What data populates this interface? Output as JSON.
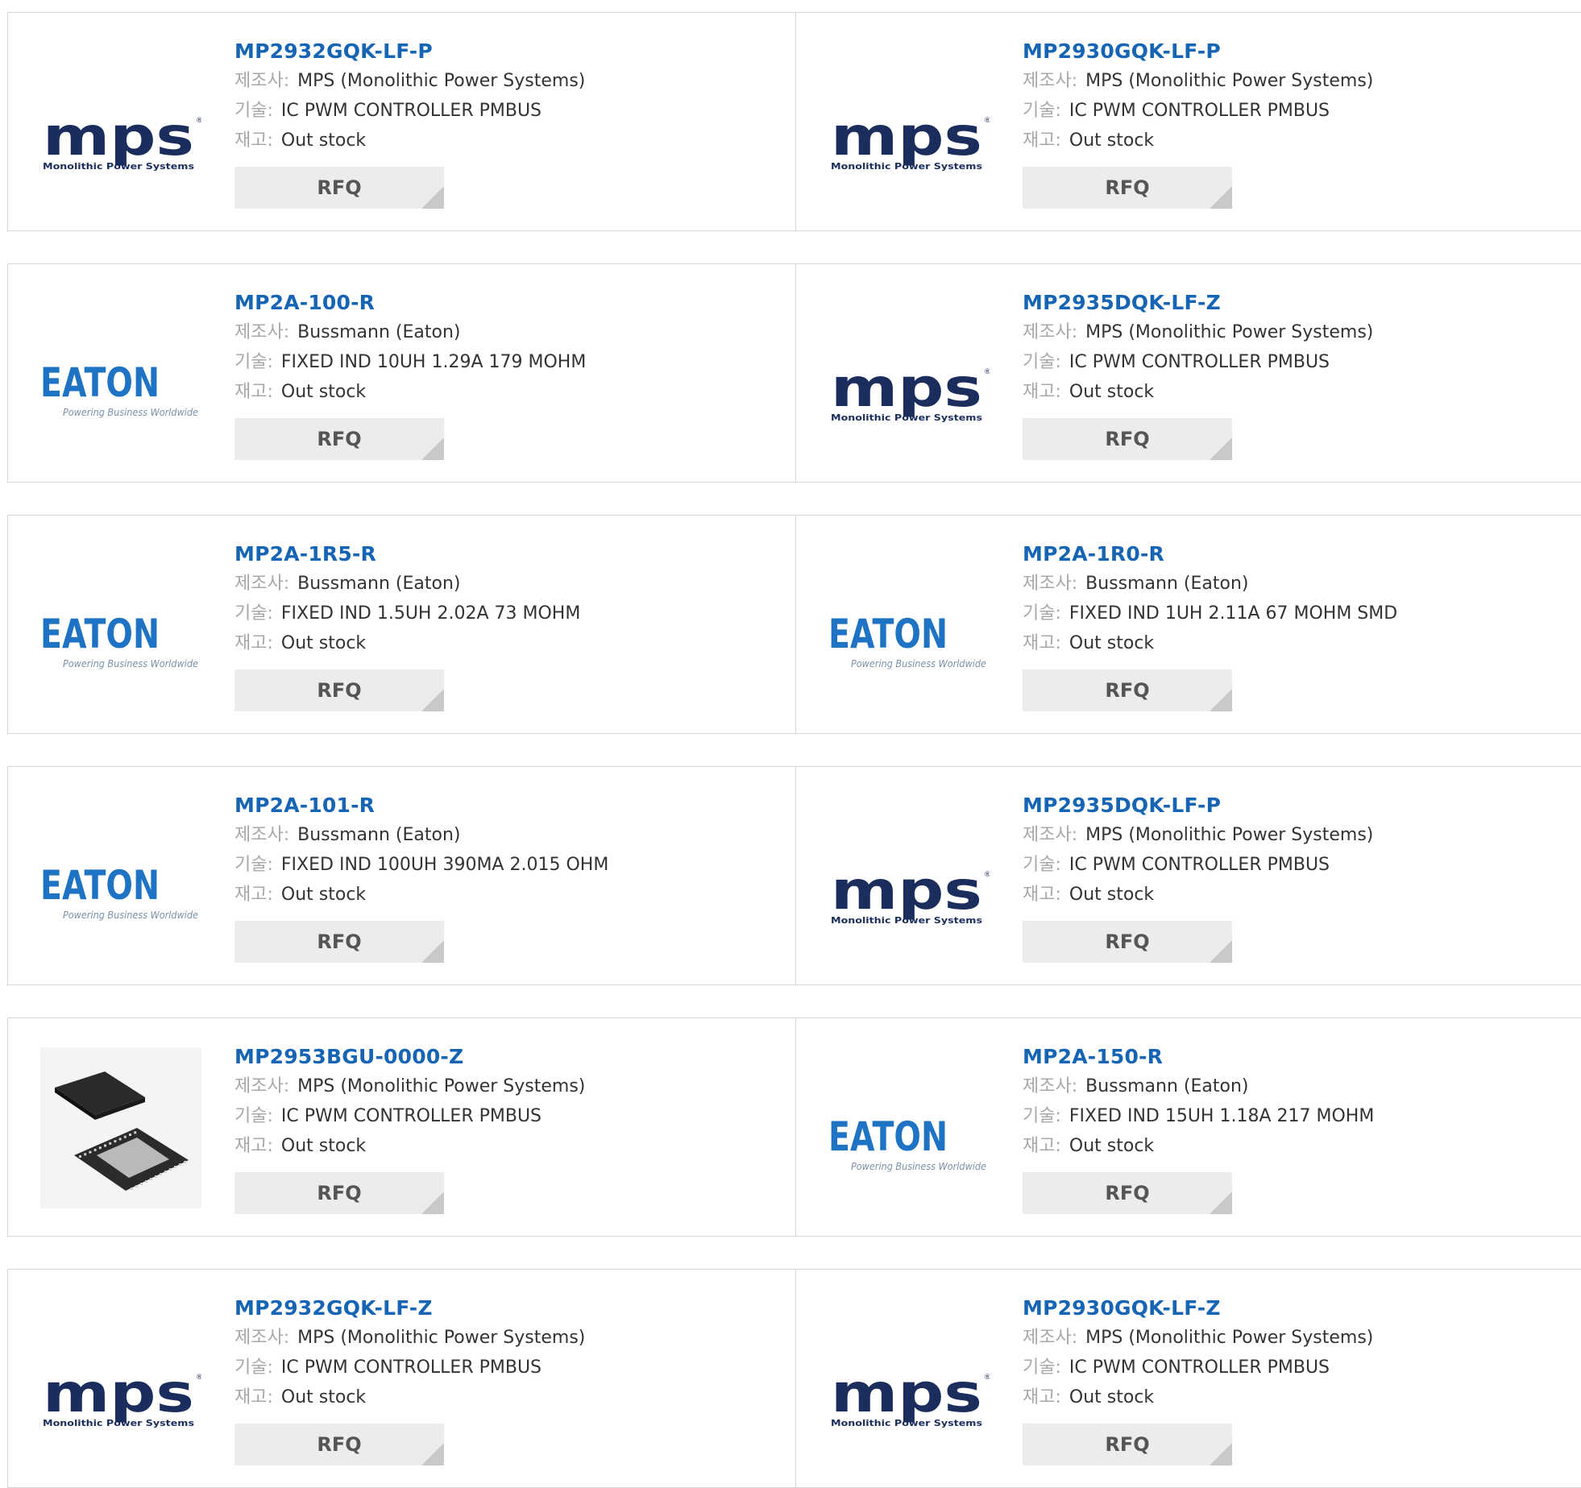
{
  "labels": {
    "manufacturer": "제조사:",
    "description": "기술:",
    "stock": "재고:"
  },
  "rfq_label": "RFQ",
  "logos": {
    "mps": {
      "text": "mps",
      "caption": "Monolithic Power Systems",
      "reg": "®"
    },
    "eaton": {
      "text": "EATON",
      "caption": "Powering Business Worldwide"
    },
    "chip": {
      "name": "qfn-chip-photo"
    }
  },
  "colors": {
    "part_link": "#1565b4",
    "mps_navy": "#1b2d5c",
    "eaton_blue": "#1f73c4",
    "label_gray": "#a8a8a8",
    "button_bg": "#ececec"
  },
  "rows": [
    {
      "products": [
        {
          "part": "MP2932GQK-LF-P",
          "logo": "mps",
          "manufacturer": "MPS (Monolithic Power Systems)",
          "description": "IC PWM CONTROLLER PMBUS",
          "stock": "Out stock"
        },
        {
          "part": "MP2930GQK-LF-P",
          "logo": "mps",
          "manufacturer": "MPS (Monolithic Power Systems)",
          "description": "IC PWM CONTROLLER PMBUS",
          "stock": "Out stock"
        }
      ]
    },
    {
      "products": [
        {
          "part": "MP2A-100-R",
          "logo": "eaton",
          "manufacturer": "Bussmann (Eaton)",
          "description": "FIXED IND 10UH 1.29A 179 MOHM",
          "stock": "Out stock"
        },
        {
          "part": "MP2935DQK-LF-Z",
          "logo": "mps",
          "manufacturer": "MPS (Monolithic Power Systems)",
          "description": "IC PWM CONTROLLER PMBUS",
          "stock": "Out stock"
        }
      ]
    },
    {
      "products": [
        {
          "part": "MP2A-1R5-R",
          "logo": "eaton",
          "manufacturer": "Bussmann (Eaton)",
          "description": "FIXED IND 1.5UH 2.02A 73 MOHM",
          "stock": "Out stock"
        },
        {
          "part": "MP2A-1R0-R",
          "logo": "eaton",
          "manufacturer": "Bussmann (Eaton)",
          "description": "FIXED IND 1UH 2.11A 67 MOHM SMD",
          "stock": "Out stock"
        }
      ]
    },
    {
      "products": [
        {
          "part": "MP2A-101-R",
          "logo": "eaton",
          "manufacturer": "Bussmann (Eaton)",
          "description": "FIXED IND 100UH 390MA 2.015 OHM",
          "stock": "Out stock"
        },
        {
          "part": "MP2935DQK-LF-P",
          "logo": "mps",
          "manufacturer": "MPS (Monolithic Power Systems)",
          "description": "IC PWM CONTROLLER PMBUS",
          "stock": "Out stock"
        }
      ]
    },
    {
      "products": [
        {
          "part": "MP2953BGU-0000-Z",
          "logo": "chip",
          "manufacturer": "MPS (Monolithic Power Systems)",
          "description": "IC PWM CONTROLLER PMBUS",
          "stock": "Out stock"
        },
        {
          "part": "MP2A-150-R",
          "logo": "eaton",
          "manufacturer": "Bussmann (Eaton)",
          "description": "FIXED IND 15UH 1.18A 217 MOHM",
          "stock": "Out stock"
        }
      ]
    },
    {
      "products": [
        {
          "part": "MP2932GQK-LF-Z",
          "logo": "mps",
          "manufacturer": "MPS (Monolithic Power Systems)",
          "description": "IC PWM CONTROLLER PMBUS",
          "stock": "Out stock"
        },
        {
          "part": "MP2930GQK-LF-Z",
          "logo": "mps",
          "manufacturer": "MPS (Monolithic Power Systems)",
          "description": "IC PWM CONTROLLER PMBUS",
          "stock": "Out stock"
        }
      ]
    }
  ]
}
